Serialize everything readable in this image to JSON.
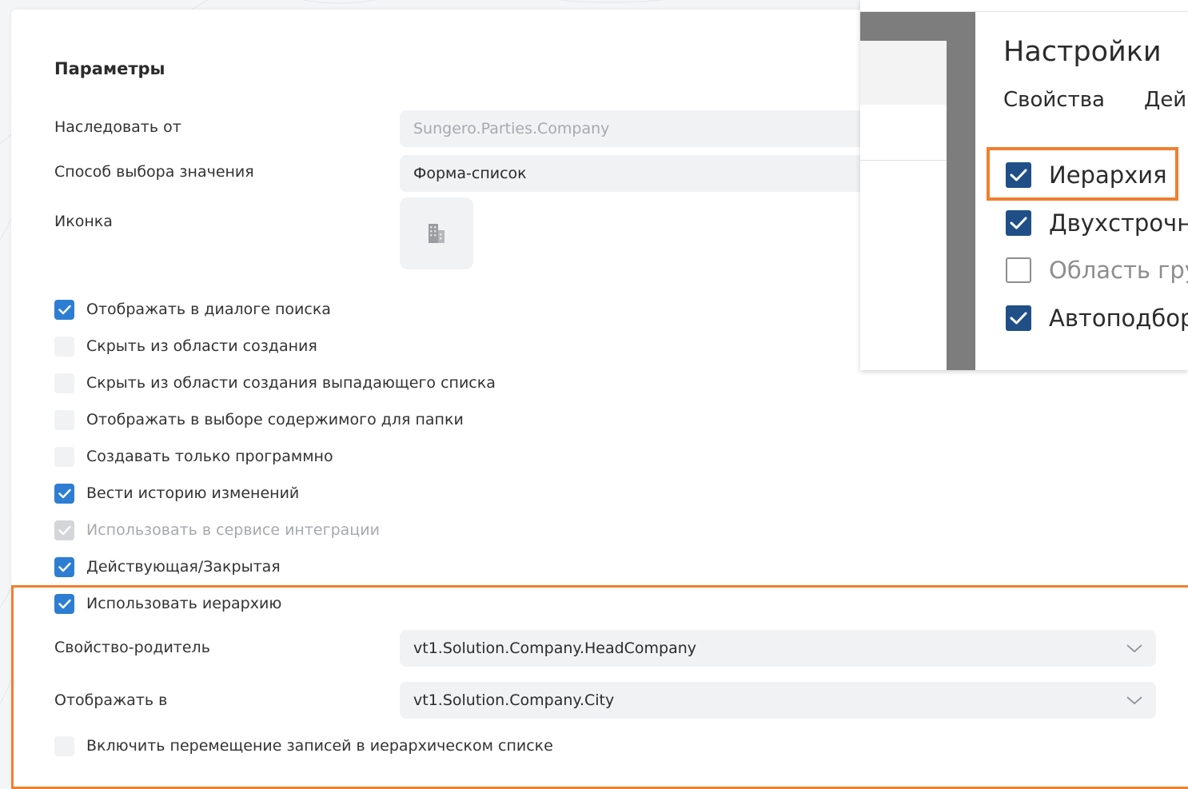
{
  "colors": {
    "accent_blue": "#2d7ed3",
    "highlight_orange": "#f07f2f",
    "overlay_check": "#1f4f86"
  },
  "params": {
    "title": "Параметры",
    "inherit": {
      "label": "Наследовать от",
      "value": "Sungero.Parties.Company"
    },
    "selection": {
      "label": "Способ выбора значения",
      "value": "Форма-список"
    },
    "icon": {
      "label": "Иконка",
      "glyph": "building-icon"
    },
    "checkboxes": [
      {
        "label": "Отображать в диалоге поиска",
        "state": "checked"
      },
      {
        "label": "Скрыть из области создания",
        "state": "unchecked"
      },
      {
        "label": "Скрыть из области создания выпадающего списка",
        "state": "unchecked"
      },
      {
        "label": "Отображать в выборе содержимого для папки",
        "state": "unchecked"
      },
      {
        "label": "Создавать только программно",
        "state": "unchecked"
      },
      {
        "label": "Вести историю изменений",
        "state": "checked"
      },
      {
        "label": "Использовать в сервисе интеграции",
        "state": "disabled"
      },
      {
        "label": "Действующая/Закрытая",
        "state": "checked"
      },
      {
        "label": "Использовать иерархию",
        "state": "checked"
      }
    ],
    "parent_property": {
      "label": "Свойство-родитель",
      "value": "vt1.Solution.Company.HeadCompany"
    },
    "display_in": {
      "label": "Отображать в",
      "value": "vt1.Solution.Company.City"
    },
    "move_records": {
      "label": "Включить перемещение записей в иерархическом списке",
      "state": "unchecked"
    }
  },
  "overlay": {
    "title": "Настройки",
    "tabs": [
      "Свойства",
      "Дей"
    ],
    "items": [
      {
        "label": "Иерархия",
        "state": "checked"
      },
      {
        "label": "Двухстрочны",
        "state": "checked"
      },
      {
        "label": "Область гру",
        "state": "unchecked"
      },
      {
        "label": "Автоподбор",
        "state": "checked"
      }
    ]
  }
}
